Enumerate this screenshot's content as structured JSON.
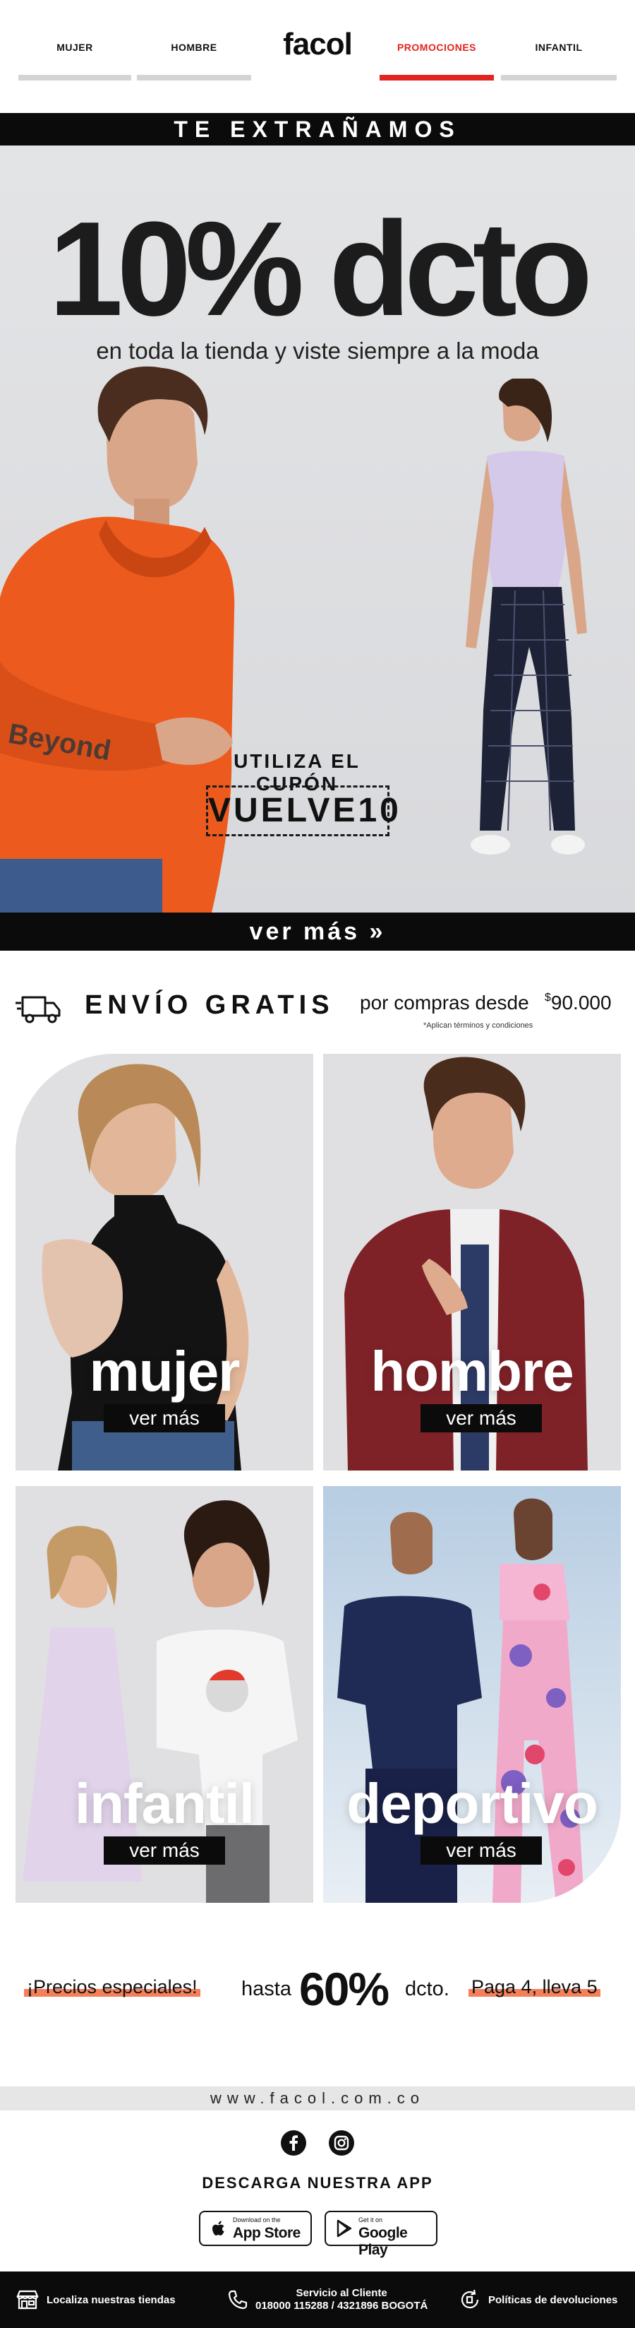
{
  "nav": {
    "items": [
      {
        "label": "MUJER",
        "active": false
      },
      {
        "label": "HOMBRE",
        "active": false
      },
      {
        "label": "PROMOCIONES",
        "active": true
      },
      {
        "label": "INFANTIL",
        "active": false
      }
    ],
    "logo": "facol",
    "accent_color": "#e3251f"
  },
  "hero": {
    "strip": "TE EXTRAÑAMOS",
    "headline": "10% dcto",
    "subheadline": "en toda la tienda y viste siempre a la moda",
    "shirt_print": "Beyond",
    "coupon_label": "UTILIZA EL CUPÓN",
    "coupon_code": "VUELVE10",
    "cta": "ver más »"
  },
  "shipping": {
    "icon": "truck-icon",
    "title": "ENVÍO GRATIS",
    "desc": "por compras desde",
    "currency": "$",
    "amount": "90.000",
    "note": "*Aplican términos y condiciones"
  },
  "categories": [
    {
      "name": "mujer",
      "cta": "ver más"
    },
    {
      "name": "hombre",
      "cta": "ver más"
    },
    {
      "name": "infantil",
      "cta": "ver más"
    },
    {
      "name": "deportivo",
      "cta": "ver más"
    }
  ],
  "promo": {
    "special": "¡Precios especiales!",
    "upto": "hasta",
    "percent": "60%",
    "dcto": "dcto.",
    "deal": "Paga 4, lleva 5",
    "highlight_color": "#f26a3d"
  },
  "footer": {
    "url": "www.facol.com.co",
    "social": [
      "facebook-icon",
      "instagram-icon"
    ],
    "app_title": "DESCARGA NUESTRA APP",
    "app_store": {
      "small": "Download on the",
      "big": "App Store"
    },
    "google_play": {
      "small": "Get it on",
      "big": "Google Play"
    },
    "bar": {
      "stores": "Localiza nuestras tiendas",
      "service_title": "Servicio al Cliente",
      "service_phones": "018000 115288 / 4321896 BOGOTÁ",
      "returns": "Políticas de devoluciones"
    }
  }
}
